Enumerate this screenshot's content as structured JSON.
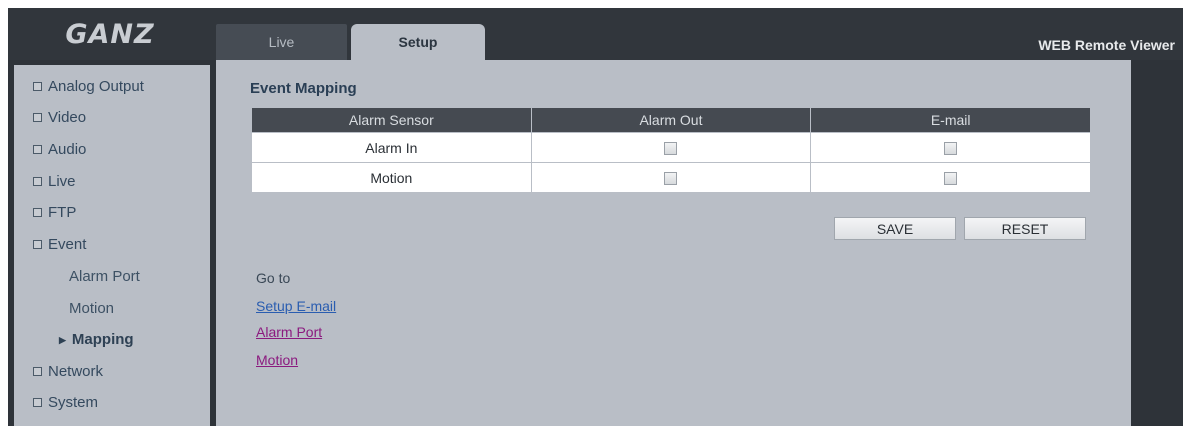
{
  "header": {
    "logo": "GANZ",
    "tabs": [
      {
        "label": "Live"
      },
      {
        "label": "Setup"
      }
    ],
    "title": "WEB Remote Viewer"
  },
  "sidebar": {
    "items": [
      {
        "label": "Analog Output"
      },
      {
        "label": "Video"
      },
      {
        "label": "Audio"
      },
      {
        "label": "Live"
      },
      {
        "label": "FTP"
      },
      {
        "label": "Event"
      },
      {
        "label": "Alarm Port"
      },
      {
        "label": "Motion"
      },
      {
        "label": "Mapping"
      },
      {
        "label": "Network"
      },
      {
        "label": "System"
      }
    ]
  },
  "main": {
    "title": "Event Mapping",
    "table": {
      "headers": [
        "Alarm Sensor",
        "Alarm Out",
        "E-mail"
      ],
      "rows": [
        {
          "sensor": "Alarm In",
          "alarm_out": false,
          "email": false
        },
        {
          "sensor": "Motion",
          "alarm_out": false,
          "email": false
        }
      ]
    },
    "save_label": "SAVE",
    "reset_label": "RESET",
    "goto_label": "Go to",
    "links": [
      {
        "label": "Setup E-mail"
      },
      {
        "label": "Alarm Port"
      },
      {
        "label": "Motion"
      }
    ]
  },
  "colors": {
    "panel": "#b9bec6",
    "dark": "#2e3339",
    "table_header": "#454a51"
  }
}
